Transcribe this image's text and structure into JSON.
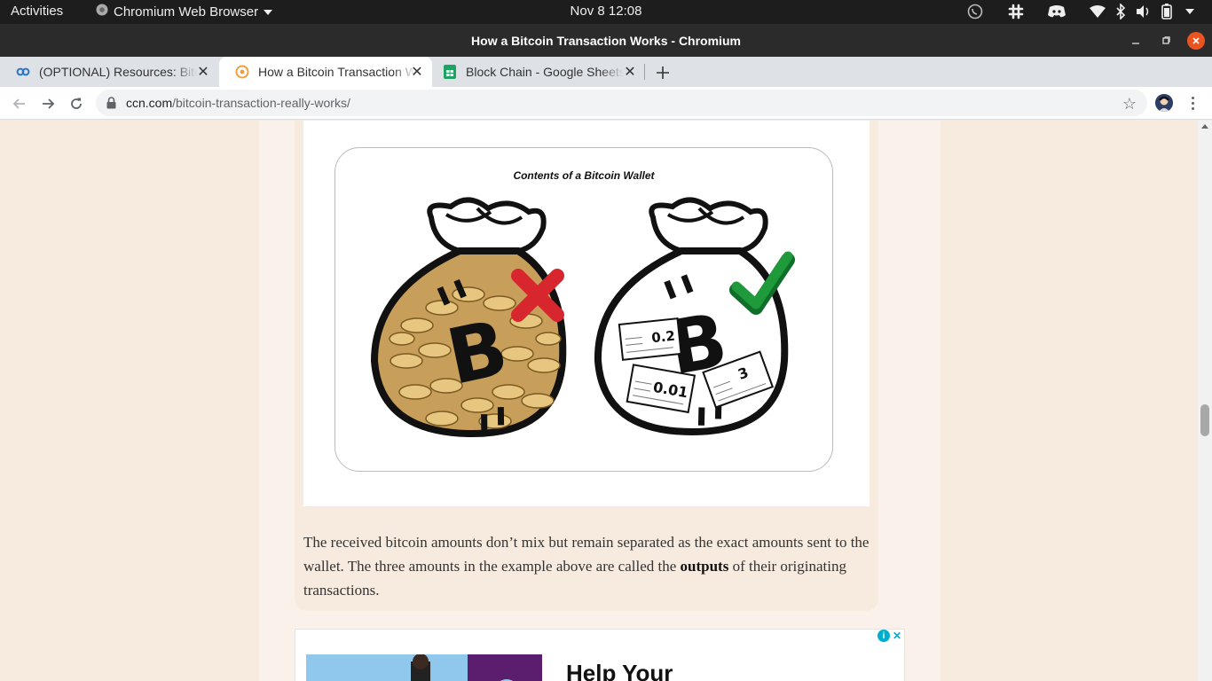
{
  "topbar": {
    "activities": "Activities",
    "app_name": "Chromium Web Browser",
    "clock": "Nov 8  12:08"
  },
  "window": {
    "title": "How a Bitcoin Transaction Works - Chromium"
  },
  "tabs": [
    {
      "label": "(OPTIONAL) Resources: Bitcoin",
      "favicon": "coursera-icon"
    },
    {
      "label": "How a Bitcoin Transaction Works",
      "favicon": "ccn-icon"
    },
    {
      "label": "Block Chain - Google Sheets",
      "favicon": "google-sheets-icon"
    }
  ],
  "toolbar": {
    "url_domain": "ccn.com",
    "url_path": "/bitcoin-transaction-really-works/"
  },
  "figure": {
    "caption": "Contents of a Bitcoin Wallet",
    "amounts": [
      "0.2",
      "0.01",
      "3"
    ]
  },
  "article": {
    "para_before": "The received bitcoin amounts don’t mix but remain separated as the exact amounts sent to the wallet. The three amounts in the example above are called the ",
    "para_bold": "outputs",
    "para_after": " of their originating transactions."
  },
  "ad": {
    "headline": "Help Your"
  },
  "colors": {
    "page_bg": "#f7ebe0",
    "accent_close": "#e95420",
    "check_green": "#1e9a3a",
    "cross_red": "#d7262d"
  }
}
